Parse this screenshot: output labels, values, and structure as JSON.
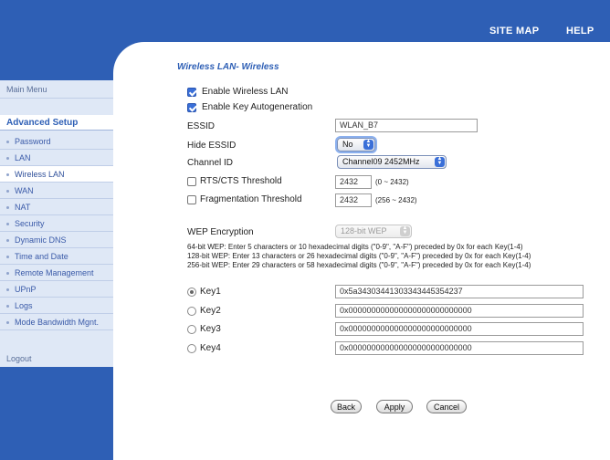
{
  "header": {
    "site_map": "SITE MAP",
    "help": "HELP"
  },
  "sidebar": {
    "main_menu": "Main Menu",
    "section": "Advanced Setup",
    "items": [
      {
        "label": "Password"
      },
      {
        "label": "LAN"
      },
      {
        "label": "Wireless LAN"
      },
      {
        "label": "WAN"
      },
      {
        "label": "NAT"
      },
      {
        "label": "Security"
      },
      {
        "label": "Dynamic DNS"
      },
      {
        "label": "Time and Date"
      },
      {
        "label": "Remote Management"
      },
      {
        "label": "UPnP"
      },
      {
        "label": "Logs"
      },
      {
        "label": "Mode Bandwidth Mgnt."
      }
    ],
    "logout": "Logout"
  },
  "page": {
    "title": "Wireless LAN- Wireless"
  },
  "form": {
    "enable_wireless_label": "Enable Wireless LAN",
    "enable_wireless_checked": true,
    "enable_key_label": "Enable Key Autogeneration",
    "enable_key_checked": true,
    "essid_label": "ESSID",
    "essid_value": "WLAN_B7",
    "hide_essid_label": "Hide ESSID",
    "hide_essid_value": "No",
    "channel_label": "Channel ID",
    "channel_value": "Channel09 2452MHz",
    "rts_label": "RTS/CTS Threshold",
    "rts_value": "2432",
    "rts_range": "(0 ~ 2432)",
    "frag_label": "Fragmentation Threshold",
    "frag_value": "2432",
    "frag_range": "(256 ~ 2432)",
    "wep_label": "WEP Encryption",
    "wep_value": "128-bit WEP",
    "wep_notes": [
      "64-bit WEP: Enter 5 characters or 10 hexadecimal digits (\"0-9\", \"A-F\") preceded by 0x for each Key(1-4)",
      "128-bit WEP: Enter 13 characters or 26 hexadecimal digits (\"0-9\", \"A-F\") preceded by 0x for each Key(1-4)",
      "256-bit WEP: Enter 29 characters or 58 hexadecimal digits (\"0-9\", \"A-F\") preceded by 0x for each Key(1-4)"
    ],
    "keys": [
      {
        "label": "Key1",
        "value": "0x5a34303441303343445354237"
      },
      {
        "label": "Key2",
        "value": "0x000000000000000000000000000"
      },
      {
        "label": "Key3",
        "value": "0x000000000000000000000000000"
      },
      {
        "label": "Key4",
        "value": "0x000000000000000000000000000"
      }
    ]
  },
  "buttons": {
    "back": "Back",
    "apply": "Apply",
    "cancel": "Cancel"
  }
}
